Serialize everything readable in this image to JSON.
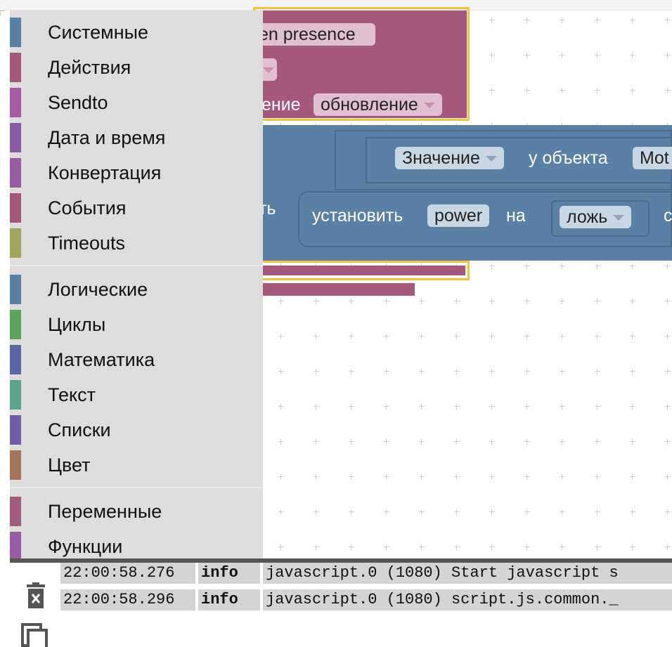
{
  "blocks": {
    "trigger_presence": "en presence",
    "trigger_change_label": "ение",
    "trigger_change_value": "обновление",
    "get_value_dropdown": "Значение",
    "of_object": "у объекта",
    "object_name": "Mot",
    "set_prefix": "ть",
    "set_label": "установить",
    "set_field": "power",
    "set_on": "на",
    "bool_value": "ложь",
    "cut_letter": "с"
  },
  "toolbox": {
    "groups": [
      [
        {
          "label": "Системные",
          "color": "#5b80a5"
        },
        {
          "label": "Действия",
          "color": "#a5577c"
        },
        {
          "label": "Sendto",
          "color": "#a55ba5"
        },
        {
          "label": "Дата и время",
          "color": "#895ba5"
        },
        {
          "label": "Конвертация",
          "color": "#9a5ba5"
        },
        {
          "label": "События",
          "color": "#a5577c"
        },
        {
          "label": "Timeouts",
          "color": "#a0a55b"
        }
      ],
      [
        {
          "label": "Логические",
          "color": "#5b80a5"
        },
        {
          "label": "Циклы",
          "color": "#5ba55b"
        },
        {
          "label": "Математика",
          "color": "#5b67a5"
        },
        {
          "label": "Текст",
          "color": "#5ba58c"
        },
        {
          "label": "Списки",
          "color": "#745ba5"
        },
        {
          "label": "Цвет",
          "color": "#a5745b"
        }
      ],
      [
        {
          "label": "Переменные",
          "color": "#a55b80"
        },
        {
          "label": "Функции",
          "color": "#9a5ba5"
        }
      ]
    ]
  },
  "log": {
    "rows": [
      {
        "time": "22:00:58.276",
        "level": "info",
        "message": "javascript.0 (1080) Start javascript s"
      },
      {
        "time": "22:00:58.296",
        "level": "info",
        "message": "javascript.0 (1080) script.js.common._"
      }
    ]
  },
  "icons": {
    "delete": "trash-icon",
    "copy": "copy-icon"
  }
}
